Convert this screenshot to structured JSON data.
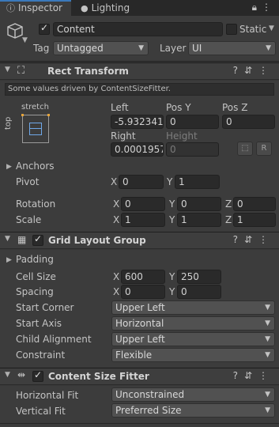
{
  "tabs": [
    {
      "label": "Inspector",
      "icon": "info-icon"
    },
    {
      "label": "Lighting",
      "icon": "bulb-icon"
    }
  ],
  "object": {
    "name": "Content",
    "static_label": "Static",
    "tag_label": "Tag",
    "tag_value": "Untagged",
    "layer_label": "Layer",
    "layer_value": "UI"
  },
  "rect_transform": {
    "title": "Rect Transform",
    "notice": "Some values driven by ContentSizeFitter.",
    "anchor_h": "stretch",
    "anchor_v": "top",
    "left_label": "Left",
    "left_value": "-5.932341",
    "posy_label": "Pos Y",
    "posy_value": "0",
    "posz_label": "Pos Z",
    "posz_value": "0",
    "right_label": "Right",
    "right_value": "0.0001957",
    "height_label": "Height",
    "height_value": "0",
    "raw_button": "R",
    "anchors_label": "Anchors",
    "pivot_label": "Pivot",
    "pivot_x": "0",
    "pivot_y": "1",
    "rotation_label": "Rotation",
    "rotation": {
      "x": "0",
      "y": "0",
      "z": "0"
    },
    "scale_label": "Scale",
    "scale": {
      "x": "1",
      "y": "1",
      "z": "1"
    }
  },
  "grid_layout": {
    "title": "Grid Layout Group",
    "padding_label": "Padding",
    "cell_size_label": "Cell Size",
    "cell_x": "600",
    "cell_y": "250",
    "spacing_label": "Spacing",
    "spacing_x": "0",
    "spacing_y": "0",
    "start_corner_label": "Start Corner",
    "start_corner_value": "Upper Left",
    "start_axis_label": "Start Axis",
    "start_axis_value": "Horizontal",
    "child_alignment_label": "Child Alignment",
    "child_alignment_value": "Upper Left",
    "constraint_label": "Constraint",
    "constraint_value": "Flexible"
  },
  "size_fitter": {
    "title": "Content Size Fitter",
    "hfit_label": "Horizontal Fit",
    "hfit_value": "Unconstrained",
    "vfit_label": "Vertical Fit",
    "vfit_value": "Preferred Size"
  },
  "axis": {
    "x": "X",
    "y": "Y",
    "z": "Z"
  },
  "colors": {
    "accent": "#3a79bb",
    "background": "#383838",
    "anchor": "#e6a43a"
  }
}
